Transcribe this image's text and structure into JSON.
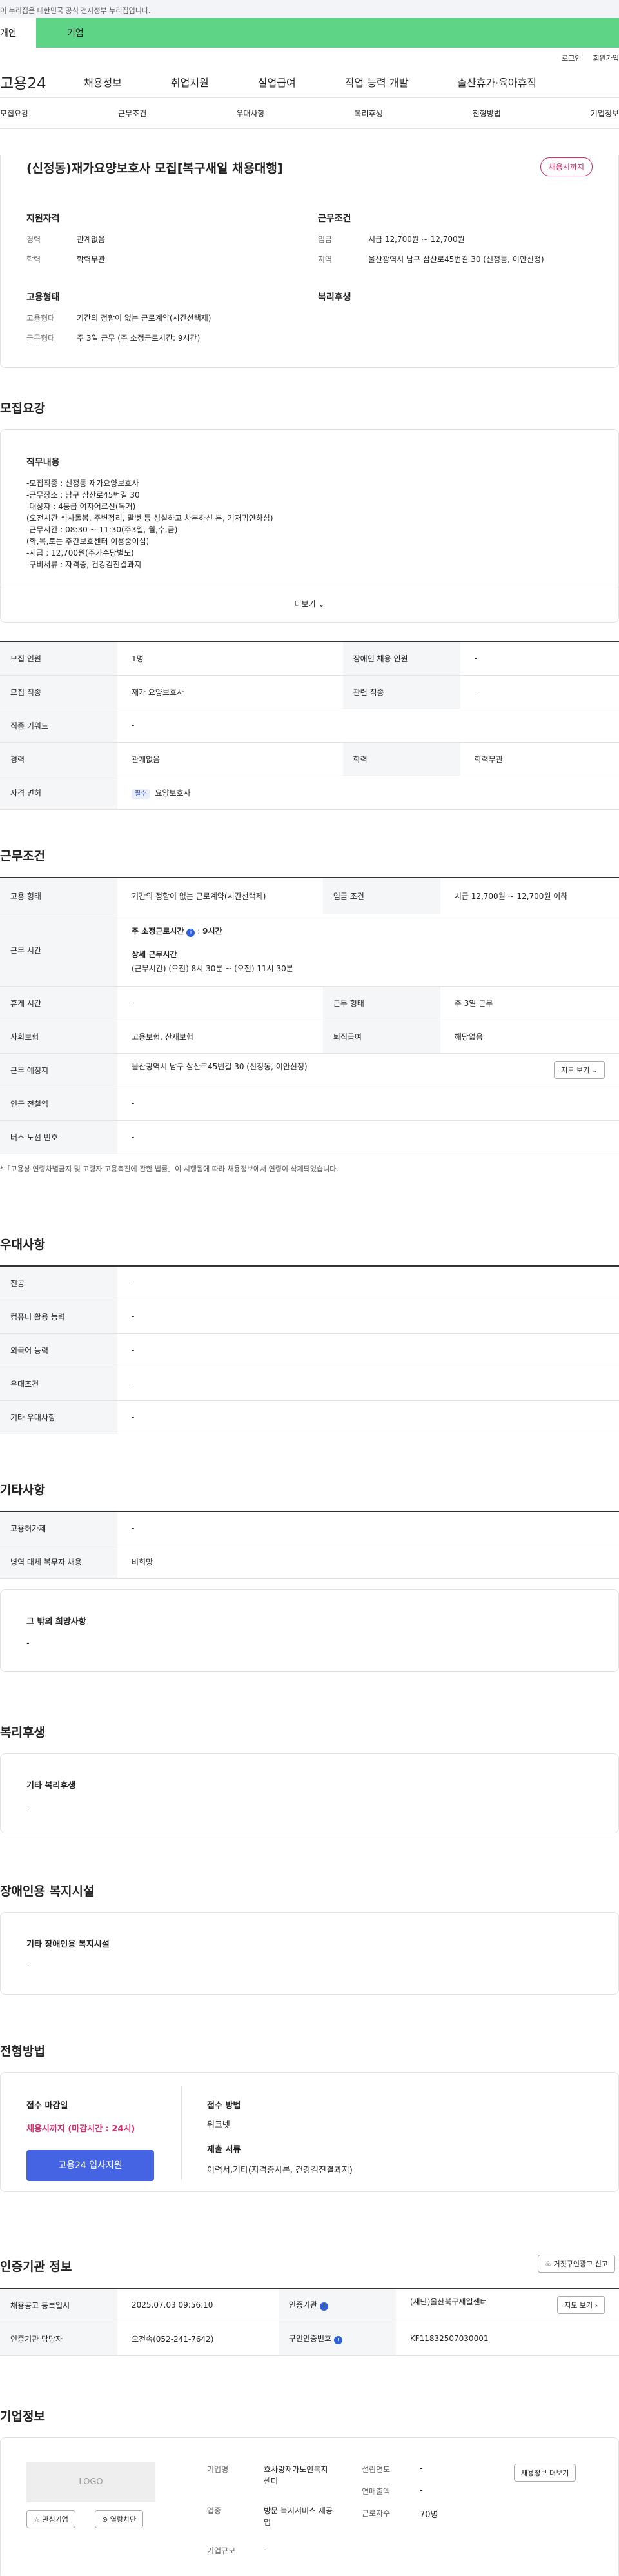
{
  "top": {
    "notice": "이 누리집은 대한민국 공식 전자정부 누리집입니다.",
    "tab_person": "개인",
    "tab_company": "기업"
  },
  "util": {
    "login": "로그인",
    "join": "회원가입"
  },
  "gnb": {
    "logo": "고용24",
    "menu": [
      "채용정보",
      "취업지원",
      "실업급여",
      "직업 능력 개발",
      "출산휴가·육아휴직"
    ]
  },
  "subnav": [
    "모집요강",
    "근무조건",
    "우대사항",
    "복리후생",
    "전형방법",
    "기업정보"
  ],
  "job": {
    "title": "(신정동)재가요양보호사 모집[복구새일 채용대행]",
    "badge": "채용시까지",
    "qual_title": "지원자격",
    "exp_label": "경력",
    "exp": "관계없음",
    "edu_label": "학력",
    "edu": "학력무관",
    "cond_title": "근무조건",
    "wage_label": "임금",
    "wage": "시급 12,700원 ~ 12,700원",
    "area_label": "지역",
    "area": "울산광역시 남구 삼산로45번길 30 (신정동, 이안신정)",
    "emp_title": "고용형태",
    "type_label": "고용형태",
    "type": "기간의 정함이 없는 근로계약(시간선택제)",
    "worktype_label": "근무형태",
    "worktype": "주 3일 근무 (주 소정근로시간: 9시간)",
    "welfare_title": "복리후생"
  },
  "recruit": {
    "title": "모집요강",
    "duty_title": "직무내용",
    "duty": "-모집직종 : 신정동 재가요양보호사\n-근무장소 : 남구 삼산로45번길 30\n-대상자 : 4등급 여자어르신(독거)\n(오전시간 식사돌봄, 주변정리, 말벗 등 성실하고 차분하신 분, 기저귀안하심)\n-근무시간 : 08:30 ~ 11:30(주3일, 월,수,금)\n(화,목,토는 주간보호센터 이용중이심)\n-시급 : 12,700원(주가수당별도)\n-구비서류 : 자격증, 건강검진결과지",
    "more": "더보기",
    "h": {
      "count": "모집 인원",
      "disabled": "장애인 채용 인원",
      "job": "모집 직종",
      "related": "관련 직종",
      "code": "직종 키워드",
      "career": "경력",
      "edu": "학력",
      "license": "자격 면허"
    },
    "v": {
      "count": "1명",
      "disabled": "-",
      "job": "재가 요양보호사",
      "related": "-",
      "code": "-",
      "career": "관계없음",
      "edu": "학력무관",
      "license_tag": "필수",
      "license": "요양보호사"
    }
  },
  "cond": {
    "title": "근무조건",
    "h": {
      "type": "고용 형태",
      "wage": "임금 조건",
      "time": "근무 시간",
      "rest": "휴게 시간",
      "form": "근무 형태",
      "ins": "사회보험",
      "retire": "퇴직급여",
      "place": "근무 예정지",
      "station": "인근 전철역",
      "bus": "버스 노선 번호"
    },
    "v": {
      "type": "기간의 정함이 없는 근로계약(시간선택제)",
      "wage": "시급 12,700원 ~ 12,700원 이하",
      "week": "주 소정근로시간",
      "week_val": "9시간",
      "detail": "상세 근무시간",
      "detail_val": "(근무시간) (오전) 8시 30분 ~ (오전) 11시 30분",
      "rest": "-",
      "form": "주 3일 근무",
      "ins": "고용보험, 산재보험",
      "retire": "해당없음",
      "place": "울산광역시 남구 삼산로45번길 30 (신정동, 이안신정)",
      "map": "지도 보기",
      "station": "-",
      "bus": "-"
    },
    "note": "*「고용상 연령차별금지 및 고령자 고용촉진에 관한 법률」이 시행됨에 따라 채용정보에서 연령이 삭제되었습니다."
  },
  "pref": {
    "title": "우대사항",
    "rows": [
      [
        "전공",
        "-"
      ],
      [
        "컴퓨터 활용 능력",
        "-"
      ],
      [
        "외국어 능력",
        "-"
      ],
      [
        "우대조건",
        "-"
      ],
      [
        "기타 우대사항",
        "-"
      ]
    ]
  },
  "etc": {
    "title": "기타사항",
    "rows": [
      [
        "고용허가제",
        "-"
      ],
      [
        "병역 대체 복무자 채용",
        "비희망"
      ]
    ],
    "hope": "그 밖의 희망사항",
    "hope_val": "-"
  },
  "welfare": {
    "title": "복리후생",
    "sub": "기타 복리후생",
    "val": "-"
  },
  "disab": {
    "title": "장애인용 복지시설",
    "sub": "기타 장애인용 복지시설",
    "val": "-"
  },
  "process": {
    "title": "전형방법",
    "deadline": "접수 마감일",
    "deadline_val": "채용시까지 (마감시간 : 24시)",
    "apply": "고용24 입사지원",
    "method": "접수 방법",
    "method_val": "워크넷",
    "docs": "제출 서류",
    "docs_val": "이력서,기타(자격증사본, 건강검진결과지)"
  },
  "agency": {
    "title": "인증기관 정보",
    "report": "거짓구인광고 신고",
    "reg_date": "채용공고 등록일시",
    "reg_val": "2025.07.03 09:56:10",
    "org": "인증기관",
    "org_val": "(재단)울산북구새일센터",
    "map": "지도 보기",
    "manager": "인증기관 담당자",
    "manager_val": "오전속(052-241-7642)",
    "num": "구인인증번호",
    "num_val": "KF11832507030001"
  },
  "company": {
    "title": "기업정보",
    "logo": "LOGO",
    "fav": "관심기업",
    "block": "열람차단",
    "name_l": "기업명",
    "name": "효사랑재가노인복지센터",
    "biz_l": "업종",
    "biz": "방문 복지서비스 제공업",
    "size_l": "기업규모",
    "size": "-",
    "est_l": "설립연도",
    "est": "-",
    "sales_l": "연매출액",
    "sales": "-",
    "emp_l": "근로자수",
    "emp": "70명",
    "jobs": "채용정보 더보기"
  }
}
